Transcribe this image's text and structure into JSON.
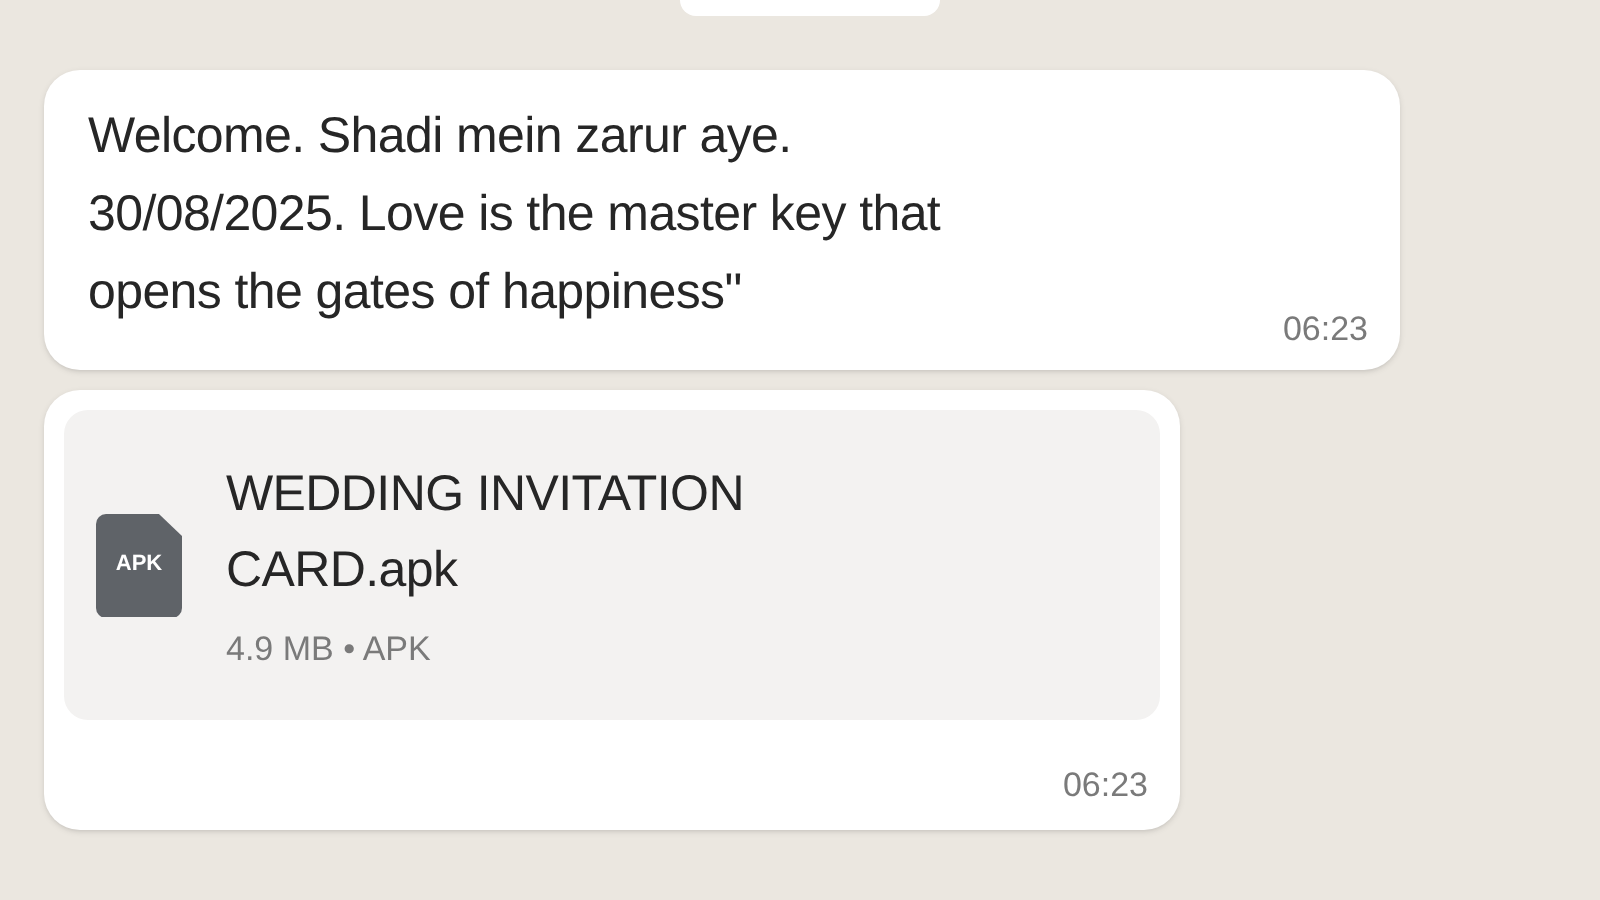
{
  "messages": [
    {
      "kind": "text",
      "text": "Welcome. Shadi mein zarur aye.\n30/08/2025. Love is the master key that\nopens the gates of happiness\"",
      "time": "06:23"
    },
    {
      "kind": "file",
      "icon_label": "APK",
      "file_name": "WEDDING INVITATION\nCARD.apk",
      "meta": "4.9 MB • APK",
      "time": "06:23"
    }
  ]
}
